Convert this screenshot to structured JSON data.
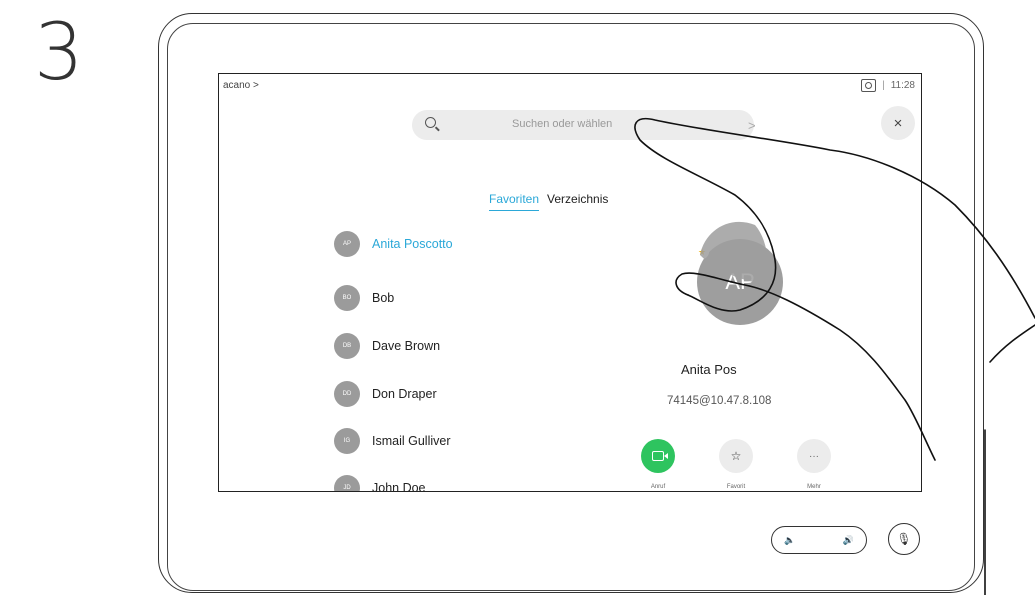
{
  "step_number": "3",
  "topbar": {
    "location": "acano >",
    "separator": "|",
    "time": "11:28"
  },
  "search": {
    "placeholder": "Suchen oder wählen",
    "close_glyph": "×",
    "chevron_glyph": ">"
  },
  "tabs": {
    "favorites": "Favoriten",
    "directory": "Verzeichnis"
  },
  "contacts": [
    {
      "initials": "AP",
      "name": "Anita Poscotto",
      "selected": true
    },
    {
      "initials": "BO",
      "name": "Bob"
    },
    {
      "initials": "DB",
      "name": "Dave Brown"
    },
    {
      "initials": "DD",
      "name": "Don Draper"
    },
    {
      "initials": "IG",
      "name": "Ismail Gulliver"
    },
    {
      "initials": "JD",
      "name": "John Doe"
    }
  ],
  "detail": {
    "avatar_initials": "AP",
    "star_glyph": "★",
    "name": "Anita Pos",
    "address": "74145@10.47.8.108"
  },
  "actions": {
    "call_label": "Anruf",
    "favorite_glyph": "☆",
    "favorite_label": "Favorit",
    "more_glyph": "···",
    "more_label": "Mehr"
  },
  "controls": {
    "vol_down_glyph": "🔈",
    "vol_up_glyph": "🔊",
    "mute_glyph": "🎙"
  },
  "colors": {
    "accent": "#2ba8d8",
    "call_green": "#2ec45f",
    "avatar_gray": "#9b9b9b",
    "star_gold": "#f2b100"
  }
}
